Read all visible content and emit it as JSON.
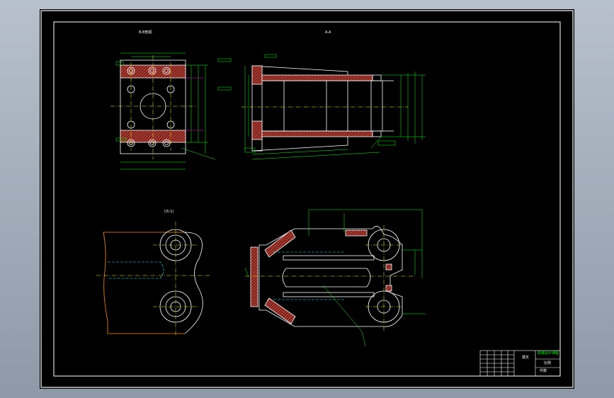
{
  "sheet": {
    "background": "#000000",
    "frame_color": "#ffffff",
    "colors": {
      "outline": "#ffffff",
      "dimension": "#00ff00",
      "center_line": "#ffff00",
      "hidden_line": "#00ffff",
      "section_hatch": "#8b1a1a",
      "hatch_line": "#ff6a3d",
      "leader": "#ff00ff"
    }
  },
  "title_block": {
    "name": "拨叉",
    "project": "机械设计课程",
    "scale_label": "比例",
    "sheet_label": "件数"
  },
  "views": {
    "section_label_1": "B-B剖视",
    "section_label_2": "A-A",
    "detail_label": "I(5:1)"
  }
}
